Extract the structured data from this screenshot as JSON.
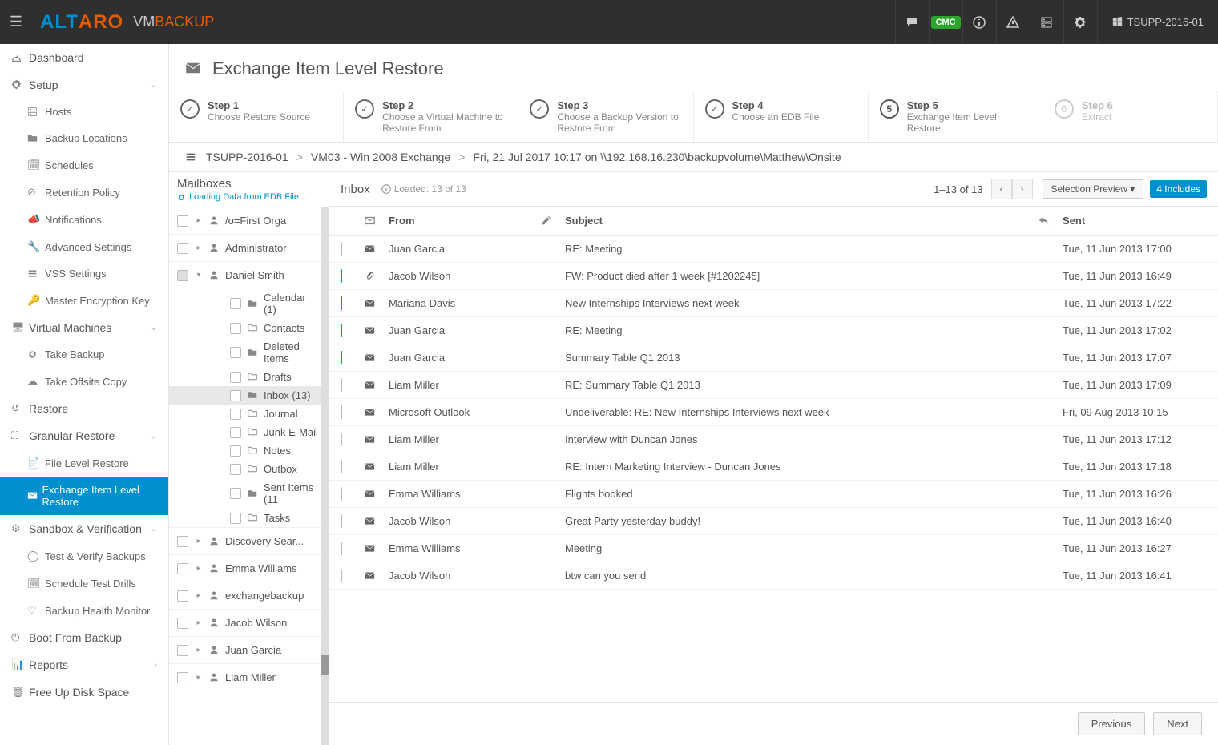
{
  "topbar": {
    "logo1": "ALT",
    "logo2": "ARO",
    "vm": "VM",
    "backup": "BACKUP",
    "cmc": "CMC",
    "host": "TSUPP-2016-01"
  },
  "sidebar": {
    "dashboard": "Dashboard",
    "setup": "Setup",
    "hosts": "Hosts",
    "backup_locations": "Backup Locations",
    "schedules": "Schedules",
    "retention": "Retention Policy",
    "notifications": "Notifications",
    "advanced": "Advanced Settings",
    "vss": "VSS Settings",
    "mek": "Master Encryption Key",
    "vms": "Virtual Machines",
    "take_backup": "Take Backup",
    "offsite": "Take Offsite Copy",
    "restore": "Restore",
    "granular": "Granular Restore",
    "flr": "File Level Restore",
    "eilr": "Exchange Item Level Restore",
    "sandbox": "Sandbox & Verification",
    "testverify": "Test & Verify Backups",
    "schedtest": "Schedule Test Drills",
    "bhm": "Backup Health Monitor",
    "boot": "Boot From Backup",
    "reports": "Reports",
    "freeup": "Free Up Disk Space"
  },
  "page": {
    "title": "Exchange Item Level Restore",
    "steps": [
      {
        "label": "Step 1",
        "desc": "Choose Restore Source",
        "done": true
      },
      {
        "label": "Step 2",
        "desc": "Choose a Virtual Machine to Restore From",
        "done": true
      },
      {
        "label": "Step 3",
        "desc": "Choose a Backup Version to Restore From",
        "done": true
      },
      {
        "label": "Step 4",
        "desc": "Choose an EDB File",
        "done": true
      },
      {
        "label": "Step 5",
        "desc": "Exchange Item Level Restore",
        "current": true,
        "num": "5"
      },
      {
        "label": "Step 6",
        "desc": "Extract",
        "disabled": true,
        "num": "6"
      }
    ],
    "crumb": {
      "a": "TSUPP-2016-01",
      "b": "VM03 - Win 2008 Exchange",
      "c": "Fri, 21 Jul 2017 10:17 on \\\\192.168.16.230\\backupvolume\\Matthew\\Onsite"
    }
  },
  "mboxes": {
    "hdr": "Mailboxes",
    "loading": "Loading Data from EDB File...",
    "items": [
      {
        "name": "/o=First Orga",
        "kind": "mb"
      },
      {
        "name": "Administrator",
        "kind": "mb"
      },
      {
        "name": "Daniel Smith",
        "kind": "mb",
        "expanded": true,
        "partial": true,
        "folders": [
          {
            "name": "Calendar (1)",
            "icon": "folder"
          },
          {
            "name": "Contacts",
            "icon": "folder-o"
          },
          {
            "name": "Deleted Items",
            "icon": "folder"
          },
          {
            "name": "Drafts",
            "icon": "folder-o"
          },
          {
            "name": "Inbox (13)",
            "icon": "folder",
            "selected": true
          },
          {
            "name": "Journal",
            "icon": "folder-o"
          },
          {
            "name": "Junk E-Mail",
            "icon": "folder-o"
          },
          {
            "name": "Notes",
            "icon": "folder-o"
          },
          {
            "name": "Outbox",
            "icon": "folder-o"
          },
          {
            "name": "Sent Items (11",
            "icon": "folder"
          },
          {
            "name": "Tasks",
            "icon": "folder-o"
          }
        ]
      },
      {
        "name": "Discovery Sear...",
        "kind": "mb"
      },
      {
        "name": "Emma Williams",
        "kind": "mb"
      },
      {
        "name": "exchangebackup",
        "kind": "mb"
      },
      {
        "name": "Jacob Wilson",
        "kind": "mb"
      },
      {
        "name": "Juan Garcia",
        "kind": "mb"
      },
      {
        "name": "Liam Miller",
        "kind": "mb"
      }
    ]
  },
  "mail": {
    "folder": "Inbox",
    "loaded": "Loaded: 13 of 13",
    "range_a": "1–13",
    "range_of": "of",
    "range_b": "13",
    "selprev": "Selection Preview",
    "includes": "4 Includes",
    "cols": {
      "from": "From",
      "subject": "Subject",
      "sent": "Sent"
    },
    "rows": [
      {
        "checked": false,
        "att": false,
        "from": "Juan Garcia",
        "subject": "RE: Meeting",
        "sent": "Tue, 11 Jun 2013 17:00"
      },
      {
        "checked": true,
        "att": true,
        "from": "Jacob Wilson",
        "subject": "FW: Product died after 1 week [#1202245]",
        "sent": "Tue, 11 Jun 2013 16:49"
      },
      {
        "checked": true,
        "att": false,
        "from": "Mariana Davis",
        "subject": "New Internships Interviews next week",
        "sent": "Tue, 11 Jun 2013 17:22"
      },
      {
        "checked": true,
        "att": false,
        "from": "Juan Garcia",
        "subject": "RE: Meeting",
        "sent": "Tue, 11 Jun 2013 17:02"
      },
      {
        "checked": true,
        "att": false,
        "from": "Juan Garcia",
        "subject": "Summary Table Q1 2013",
        "sent": "Tue, 11 Jun 2013 17:07"
      },
      {
        "checked": false,
        "att": false,
        "from": "Liam Miller",
        "subject": "RE: Summary Table Q1 2013",
        "sent": "Tue, 11 Jun 2013 17:09"
      },
      {
        "checked": false,
        "att": false,
        "from": "Microsoft Outlook",
        "subject": "Undeliverable: RE: New Internships Interviews next week",
        "sent": "Fri, 09 Aug 2013 10:15"
      },
      {
        "checked": false,
        "att": false,
        "from": "Liam Miller",
        "subject": "Interview with Duncan Jones",
        "sent": "Tue, 11 Jun 2013 17:12"
      },
      {
        "checked": false,
        "att": false,
        "from": "Liam Miller",
        "subject": "RE: Intern Marketing Interview - Duncan Jones",
        "sent": "Tue, 11 Jun 2013 17:18"
      },
      {
        "checked": false,
        "att": false,
        "from": "Emma Williams",
        "subject": "Flights booked",
        "sent": "Tue, 11 Jun 2013 16:26"
      },
      {
        "checked": false,
        "att": false,
        "from": "Jacob Wilson",
        "subject": "Great Party yesterday buddy!",
        "sent": "Tue, 11 Jun 2013 16:40"
      },
      {
        "checked": false,
        "att": false,
        "from": "Emma Williams",
        "subject": "Meeting",
        "sent": "Tue, 11 Jun 2013 16:27"
      },
      {
        "checked": false,
        "att": false,
        "from": "Jacob Wilson",
        "subject": "btw can you send",
        "sent": "Tue, 11 Jun 2013 16:41"
      }
    ]
  },
  "footer": {
    "prev": "Previous",
    "next": "Next"
  }
}
